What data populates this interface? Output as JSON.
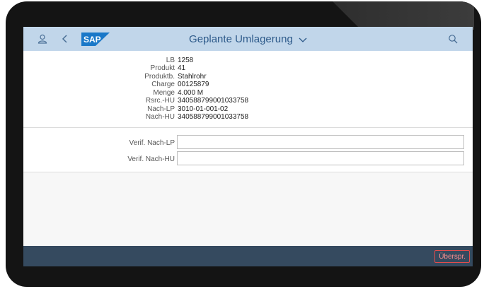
{
  "header": {
    "title": "Geplante Umlagerung",
    "user_icon": "user-icon",
    "back_icon": "back-icon",
    "search_icon": "search-icon",
    "title_dropdown_icon": "chevron-down-icon",
    "logo_text": "SAP"
  },
  "details": [
    {
      "label": "LB",
      "value": "1258"
    },
    {
      "label": "Produkt",
      "value": "41"
    },
    {
      "label": "Produktb.",
      "value": "Stahlrohr"
    },
    {
      "label": "Charge",
      "value": "00125879"
    },
    {
      "label": "Menge",
      "value": "4.000 M"
    },
    {
      "label": "Rsrc.-HU",
      "value": "340588799001033758"
    },
    {
      "label": "Nach-LP",
      "value": "3010-01-001-02"
    },
    {
      "label": "Nach-HU",
      "value": "340588799001033758"
    }
  ],
  "form": {
    "verif_nach_lp": {
      "label": "Verif. Nach-LP",
      "value": ""
    },
    "verif_nach_hu": {
      "label": "Verif. Nach-HU",
      "value": ""
    }
  },
  "footer": {
    "skip_label": "Überspr."
  },
  "colors": {
    "shellbar": "#c1d6ea",
    "footer": "#354a5f",
    "skip_button": "#e34c4c"
  }
}
